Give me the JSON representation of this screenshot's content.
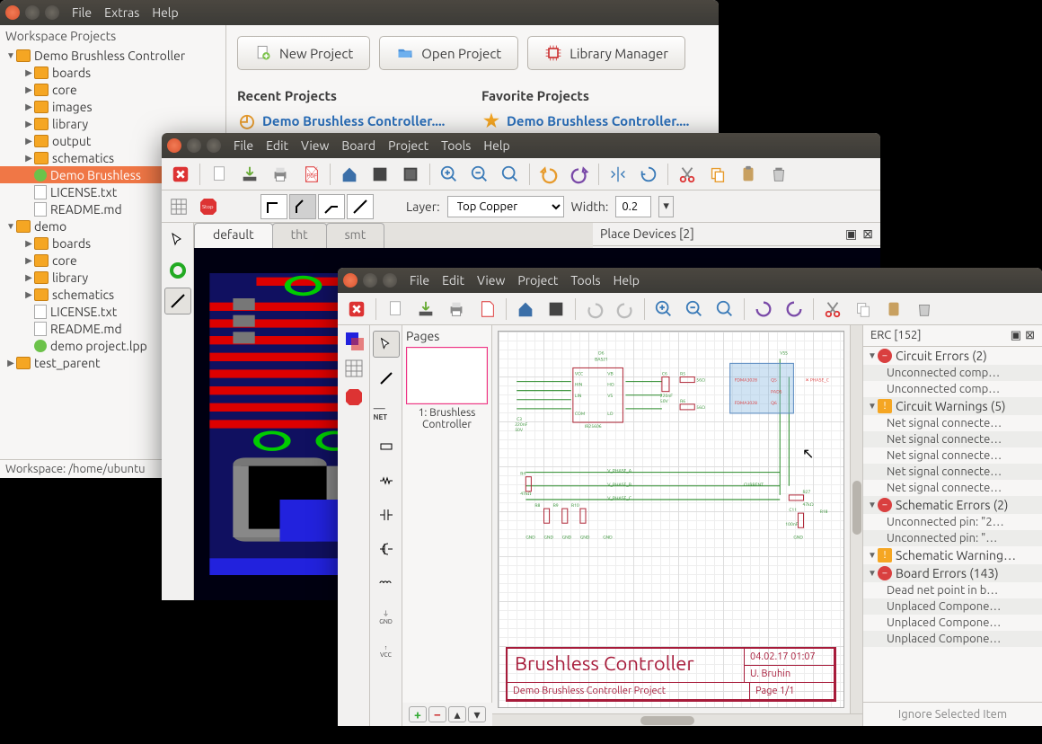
{
  "workspace": {
    "menus": [
      "File",
      "Extras",
      "Help"
    ],
    "panel_title": "Workspace Projects",
    "footer": "Workspace: /home/ubuntu",
    "tree": [
      {
        "d": 0,
        "a": "▼",
        "i": "fold",
        "t": "Demo Brushless Controller"
      },
      {
        "d": 1,
        "a": "▶",
        "i": "fold",
        "t": "boards"
      },
      {
        "d": 1,
        "a": "▶",
        "i": "fold",
        "t": "core"
      },
      {
        "d": 1,
        "a": "▶",
        "i": "fold",
        "t": "images"
      },
      {
        "d": 1,
        "a": "▶",
        "i": "fold",
        "t": "library"
      },
      {
        "d": 1,
        "a": "▶",
        "i": "fold",
        "t": "output"
      },
      {
        "d": 1,
        "a": "▶",
        "i": "fold",
        "t": "schematics"
      },
      {
        "d": 1,
        "a": "",
        "i": "prj",
        "t": "Demo Brushless",
        "sel": true
      },
      {
        "d": 1,
        "a": "",
        "i": "file",
        "t": "LICENSE.txt"
      },
      {
        "d": 1,
        "a": "",
        "i": "file",
        "t": "README.md"
      },
      {
        "d": 0,
        "a": "▼",
        "i": "fold",
        "t": "demo"
      },
      {
        "d": 1,
        "a": "▶",
        "i": "fold",
        "t": "boards"
      },
      {
        "d": 1,
        "a": "▶",
        "i": "fold",
        "t": "core"
      },
      {
        "d": 1,
        "a": "▶",
        "i": "fold",
        "t": "library"
      },
      {
        "d": 1,
        "a": "▶",
        "i": "fold",
        "t": "schematics"
      },
      {
        "d": 1,
        "a": "",
        "i": "file",
        "t": "LICENSE.txt"
      },
      {
        "d": 1,
        "a": "",
        "i": "file",
        "t": "README.md"
      },
      {
        "d": 1,
        "a": "",
        "i": "prj",
        "t": "demo project.lpp"
      },
      {
        "d": 0,
        "a": "▶",
        "i": "fold",
        "t": "test_parent"
      }
    ],
    "buttons": {
      "new": "New Project",
      "open": "Open Project",
      "lib": "Library Manager"
    },
    "recent_h": "Recent Projects",
    "fav_h": "Favorite Projects",
    "recent_link": "Demo Brushless Controller....",
    "fav_link": "Demo Brushless Controller...."
  },
  "board": {
    "menus": [
      "File",
      "Edit",
      "View",
      "Board",
      "Project",
      "Tools",
      "Help"
    ],
    "layer_label": "Layer:",
    "layer_value": "Top Copper",
    "width_label": "Width:",
    "width_value": "0.2",
    "tabs": [
      "default",
      "tht",
      "smt"
    ],
    "dock_title": "Place Devices [2]"
  },
  "schematic": {
    "menus": [
      "File",
      "Edit",
      "View",
      "Project",
      "Tools",
      "Help"
    ],
    "pages_title": "Pages",
    "page_label": "1: Brushless Controller",
    "titleblock": {
      "title": "Brushless Controller",
      "date": "04.02.17 01:07",
      "author": "U. Bruhin",
      "project": "Demo Brushless Controller Project",
      "page": "Page 1/1"
    },
    "erc": {
      "title": "ERC [152]",
      "groups": [
        {
          "label": "Circuit Errors (2)",
          "type": "err",
          "items": [
            "Unconnected comp…",
            "Unconnected comp…"
          ]
        },
        {
          "label": "Circuit Warnings (5)",
          "type": "warn",
          "items": [
            "Net signal connecte…",
            "Net signal connecte…",
            "Net signal connecte…",
            "Net signal connecte…",
            "Net signal connecte…"
          ]
        },
        {
          "label": "Schematic Errors (2)",
          "type": "err",
          "items": [
            "Unconnected pin: \"2…",
            "Unconnected pin: \"…"
          ]
        },
        {
          "label": "Schematic Warning…",
          "type": "warn",
          "items": []
        },
        {
          "label": "Board Errors (143)",
          "type": "err",
          "items": [
            "Dead net point in b…",
            "Unplaced Compone…",
            "Unplaced Compone…",
            "Unplaced Compone…"
          ]
        }
      ],
      "footer": "Ignore Selected Item"
    }
  }
}
